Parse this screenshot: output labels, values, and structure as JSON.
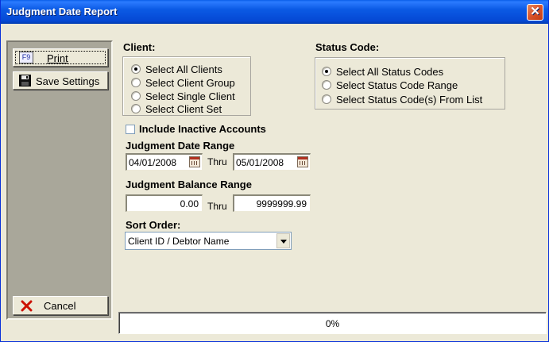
{
  "window": {
    "title": "Judgment Date Report",
    "close_glyph": "✕"
  },
  "sidebar": {
    "print_key": "F9",
    "print_label": "Print",
    "save_label": "Save Settings",
    "cancel_label": "Cancel"
  },
  "client": {
    "label": "Client:",
    "options": [
      "Select All Clients",
      "Select Client Group",
      "Select Single Client",
      "Select Client Set"
    ],
    "selected_index": 0
  },
  "status_code": {
    "label": "Status Code:",
    "options": [
      "Select All Status Codes",
      "Select Status Code Range",
      "Select Status Code(s) From List"
    ],
    "selected_index": 0
  },
  "include_inactive": {
    "label": "Include Inactive Accounts",
    "checked": false
  },
  "date_range": {
    "label": "Judgment Date Range",
    "from": "04/01/2008",
    "thru_label": "Thru",
    "to": "05/01/2008"
  },
  "balance_range": {
    "label": "Judgment Balance Range",
    "from": "0.00",
    "thru_label": "Thru",
    "to": "9999999.99"
  },
  "sort_order": {
    "label": "Sort Order:",
    "value": "Client ID / Debtor Name"
  },
  "progress": {
    "text": "0%",
    "value": 0
  },
  "icons": {
    "print": "printer-icon",
    "save": "floppy-disk-icon",
    "cancel": "red-x-icon",
    "calendar": "calendar-icon"
  },
  "colors": {
    "titlebar": "#0548d4",
    "face": "#ece9d8",
    "sidebar": "#a9a79a",
    "cancel_x": "#cc1100"
  }
}
